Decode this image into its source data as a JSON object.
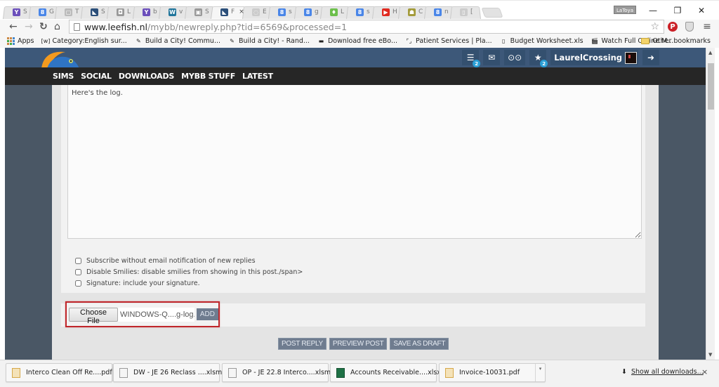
{
  "browser": {
    "tabs": [
      {
        "label": "S",
        "icon": "yahoo-icon",
        "color": "#6b4fbb",
        "glyph": "Y"
      },
      {
        "label": "G",
        "icon": "google-icon",
        "color": "#4a86e8",
        "glyph": "8"
      },
      {
        "label": "T",
        "icon": "document-icon",
        "color": "#bbbbbb",
        "glyph": "▢"
      },
      {
        "label": "S",
        "icon": "leefish-icon",
        "color": "#2b4f7a",
        "glyph": "◣"
      },
      {
        "label": "L",
        "icon": "camera-icon",
        "color": "#999999",
        "glyph": "◘"
      },
      {
        "label": "b",
        "icon": "yahoo-icon",
        "color": "#6b4fbb",
        "glyph": "Y"
      },
      {
        "label": "v",
        "icon": "wordpress-icon",
        "color": "#21759b",
        "glyph": "W"
      },
      {
        "label": "S",
        "icon": "image-icon",
        "color": "#999999",
        "glyph": "▣"
      },
      {
        "label": "F",
        "icon": "leefish-icon",
        "color": "#2b4f7a",
        "glyph": "◣",
        "active": true
      },
      {
        "label": "E",
        "icon": "loading-icon",
        "color": "#cccccc",
        "glyph": "◌"
      },
      {
        "label": "s",
        "icon": "google-icon",
        "color": "#4a86e8",
        "glyph": "8"
      },
      {
        "label": "g",
        "icon": "google-icon",
        "color": "#4a86e8",
        "glyph": "8"
      },
      {
        "label": "L",
        "icon": "leaf-icon",
        "color": "#6cbf4b",
        "glyph": "♦"
      },
      {
        "label": "s",
        "icon": "google-icon",
        "color": "#4a86e8",
        "glyph": "8"
      },
      {
        "label": "H",
        "icon": "youtube-icon",
        "color": "#e02a20",
        "glyph": "▶"
      },
      {
        "label": "C",
        "icon": "android-icon",
        "color": "#a39b3a",
        "glyph": "☗"
      },
      {
        "label": "n",
        "icon": "google-icon",
        "color": "#4a86e8",
        "glyph": "8"
      },
      {
        "label": "[",
        "icon": "document-icon",
        "color": "#cccccc",
        "glyph": "▯"
      }
    ],
    "active_tab_close": "×",
    "profile_name": "LaToya",
    "window_controls": {
      "minimize": "—",
      "restore": "❐",
      "close": "✕"
    },
    "url": {
      "host": "www.leefish.nl",
      "path": "/mybb/newreply.php?tid=6569&processed=1"
    },
    "bookmarks": [
      {
        "label": "Apps",
        "icon": "apps-grid-icon"
      },
      {
        "label": "Category:English sur...",
        "icon": "wiki-icon",
        "glyph": "[w]"
      },
      {
        "label": "Build a City! Commu...",
        "icon": "pencil-icon",
        "glyph": "✎"
      },
      {
        "label": "Build a City! - Rand...",
        "icon": "pencil-icon",
        "glyph": "✎"
      },
      {
        "label": "Download free eBo...",
        "icon": "ebook-icon",
        "glyph": "▬"
      },
      {
        "label": "Patient Services | Pla...",
        "icon": "bracket-icon",
        "glyph": "⌜⌟"
      },
      {
        "label": "Budget Worksheet.xls",
        "icon": "page-icon",
        "glyph": "▯"
      },
      {
        "label": "Watch Full Online M...",
        "icon": "clapper-icon",
        "glyph": "🎬"
      }
    ],
    "other_bookmarks": "Other bookmarks"
  },
  "site": {
    "nav": [
      "SIMS",
      "SOCIAL",
      "DOWNLOADS",
      "MYBB STUFF",
      "LATEST"
    ],
    "header_buttons": [
      {
        "name": "threads",
        "glyph": "☰",
        "badge": "2"
      },
      {
        "name": "messages",
        "glyph": "✉"
      },
      {
        "name": "games",
        "glyph": "⊙⊙"
      },
      {
        "name": "favorites",
        "glyph": "★",
        "badge": "2"
      }
    ],
    "username": "LaurelCrossing",
    "logout_glyph": "➜"
  },
  "reply_form": {
    "message": "Here's the log.",
    "options": [
      {
        "label": "Subscribe without email notification of new replies",
        "checked": false
      },
      {
        "label": "Disable Smilies: disable smilies from showing in this post./span>",
        "checked": false
      },
      {
        "label": "Signature: include your signature.",
        "checked": false
      }
    ],
    "attachment": {
      "choose_label": "Choose File",
      "file_name": "WINDOWS-Q....g-log.txt",
      "add_label": "ADD",
      "highlight_color": "#c0262b"
    },
    "buttons": {
      "post_reply": "POST REPLY",
      "preview_post": "PREVIEW POST",
      "save_draft": "SAVE AS DRAFT"
    }
  },
  "downloads": {
    "items": [
      {
        "name": "Interco Clean Off Re....pdf",
        "type": "pdf"
      },
      {
        "name": "DW - JE 26 Reclass ....xlsm",
        "type": "xls"
      },
      {
        "name": "OP - JE 22.8 Interco....xlsm",
        "type": "xls"
      },
      {
        "name": "Accounts Receivable....xlsx",
        "type": "xlsx"
      },
      {
        "name": "Invoice-10031.pdf",
        "type": "pdf"
      }
    ],
    "show_all": "Show all downloads...",
    "close": "×"
  }
}
